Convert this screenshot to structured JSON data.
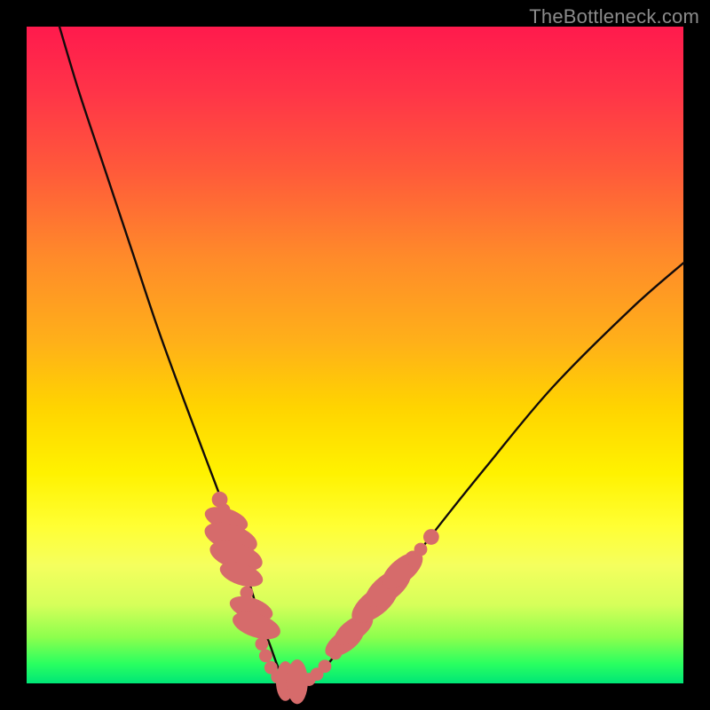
{
  "watermark": "TheBottleneck.com",
  "colors": {
    "background": "#000000",
    "gradient_top": "#ff1a4d",
    "gradient_bottom": "#00e676",
    "curve": "#120b0b",
    "markers": "#d66b6b"
  },
  "chart_data": {
    "type": "line",
    "title": "",
    "xlabel": "",
    "ylabel": "",
    "xlim": [
      0,
      100
    ],
    "ylim": [
      0,
      100
    ],
    "grid": false,
    "series": [
      {
        "name": "bottleneck-curve",
        "x": [
          5,
          8,
          12,
          16,
          20,
          24,
          27,
          30,
          32,
          34,
          35.5,
          37,
          38.5,
          40,
          42,
          45,
          50,
          56,
          62,
          70,
          80,
          92,
          100
        ],
        "y": [
          100,
          90,
          78,
          66,
          54,
          43,
          35,
          27,
          21,
          15,
          10,
          6,
          2,
          0,
          0,
          2,
          8,
          15,
          23,
          33,
          45,
          57,
          64
        ]
      }
    ],
    "markers": {
      "name": "highlight-beads",
      "segments": [
        {
          "cx": 29.4,
          "cy": 28.0,
          "r": 1.2
        },
        {
          "cx": 30.0,
          "cy": 26.4,
          "r": 1.0
        },
        {
          "cx": 30.4,
          "cy": 25.0,
          "r": 1.8,
          "elong": true,
          "angle": -72
        },
        {
          "cx": 31.1,
          "cy": 22.2,
          "r": 2.2,
          "elong": true,
          "angle": -72
        },
        {
          "cx": 31.9,
          "cy": 19.4,
          "r": 2.2,
          "elong": true,
          "angle": -72
        },
        {
          "cx": 32.7,
          "cy": 16.6,
          "r": 1.8,
          "elong": true,
          "angle": -72
        },
        {
          "cx": 33.5,
          "cy": 13.8,
          "r": 1.0
        },
        {
          "cx": 34.2,
          "cy": 11.4,
          "r": 1.8,
          "elong": true,
          "angle": -72
        },
        {
          "cx": 35.0,
          "cy": 8.8,
          "r": 2.0,
          "elong": true,
          "angle": -72
        },
        {
          "cx": 35.8,
          "cy": 6.0,
          "r": 1.0
        },
        {
          "cx": 36.4,
          "cy": 4.2,
          "r": 1.0
        },
        {
          "cx": 37.2,
          "cy": 2.4,
          "r": 1.0
        },
        {
          "cx": 38.2,
          "cy": 1.0,
          "r": 1.0
        },
        {
          "cx": 39.4,
          "cy": 0.35,
          "r": 1.6,
          "elong": true,
          "angle": 0
        },
        {
          "cx": 41.2,
          "cy": 0.25,
          "r": 1.8,
          "elong": true,
          "angle": 0
        },
        {
          "cx": 43.0,
          "cy": 0.6,
          "r": 1.0
        },
        {
          "cx": 44.2,
          "cy": 1.4,
          "r": 1.0
        },
        {
          "cx": 45.4,
          "cy": 2.6,
          "r": 1.0
        },
        {
          "cx": 47.0,
          "cy": 4.6,
          "r": 1.0
        },
        {
          "cx": 48.4,
          "cy": 6.4,
          "r": 1.8,
          "elong": true,
          "angle": 55
        },
        {
          "cx": 49.8,
          "cy": 8.2,
          "r": 1.8,
          "elong": true,
          "angle": 55
        },
        {
          "cx": 51.4,
          "cy": 10.2,
          "r": 1.0
        },
        {
          "cx": 53.0,
          "cy": 12.2,
          "r": 2.2,
          "elong": true,
          "angle": 52
        },
        {
          "cx": 55.0,
          "cy": 14.6,
          "r": 2.2,
          "elong": true,
          "angle": 52
        },
        {
          "cx": 57.2,
          "cy": 17.2,
          "r": 2.0,
          "elong": true,
          "angle": 50
        },
        {
          "cx": 58.8,
          "cy": 19.0,
          "r": 1.2
        },
        {
          "cx": 60.0,
          "cy": 20.4,
          "r": 1.0
        },
        {
          "cx": 61.6,
          "cy": 22.3,
          "r": 1.2
        }
      ]
    }
  }
}
